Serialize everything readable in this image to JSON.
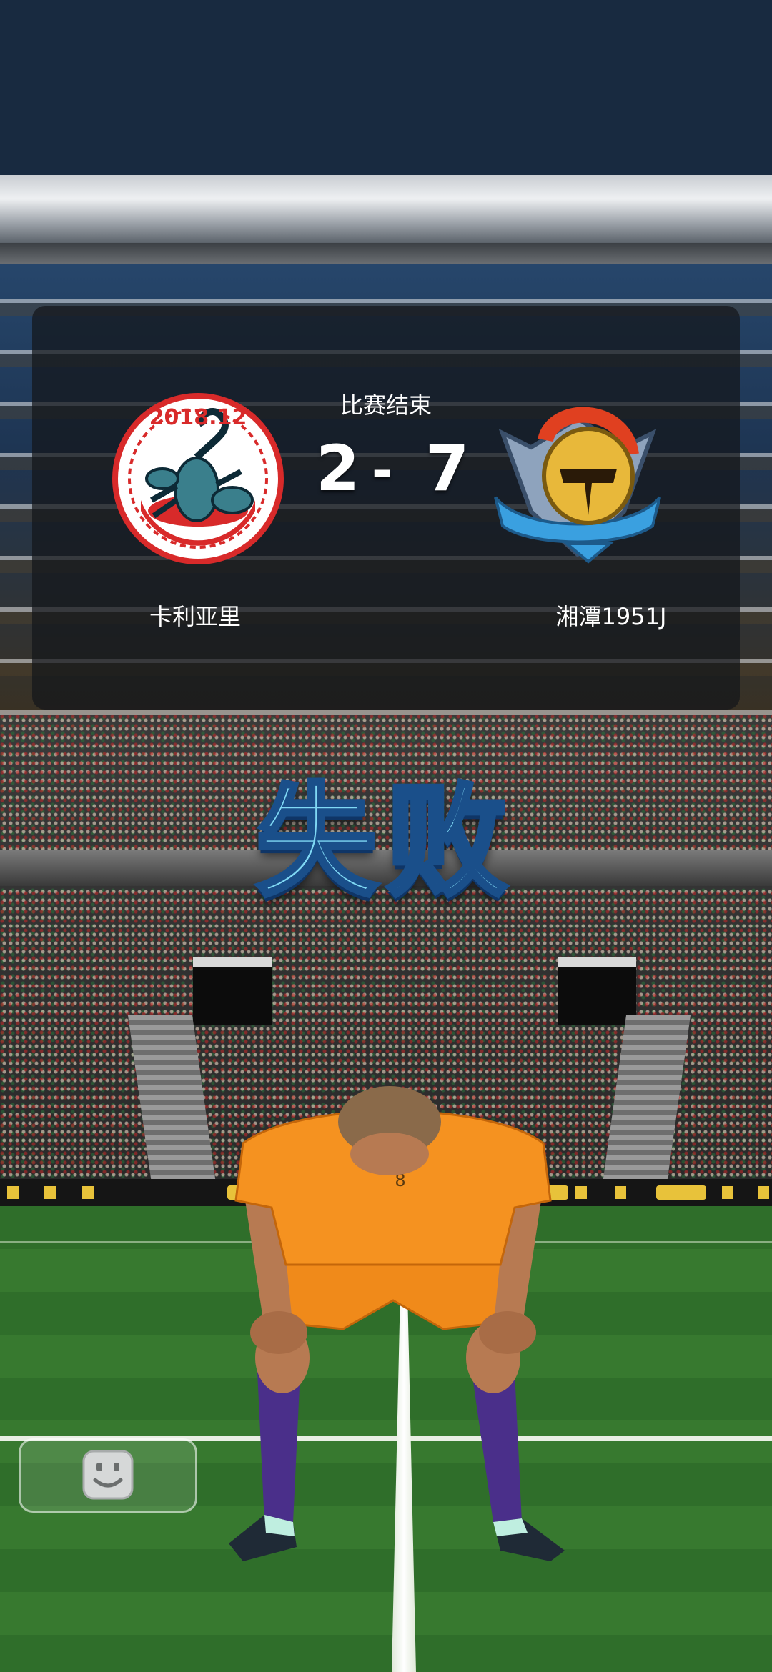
{
  "match": {
    "status_label": "比赛结束",
    "score_home": "2",
    "score_separator": "-",
    "score_away": "7",
    "home_team": {
      "name": "卡利亚里",
      "crest_text": "2018.12",
      "crest_icon": "scorpion-icon"
    },
    "away_team": {
      "name": "湘潭1951J",
      "crest_icon": "golden-helmet-icon"
    }
  },
  "result": {
    "label": "失败"
  },
  "player": {
    "jersey_number": "8"
  },
  "controls": {
    "chat_icon": "smiley-face-icon"
  },
  "colors": {
    "defeat_text": "#7fd8f4",
    "jersey": "#f08a1a",
    "pitch": "#37792f"
  }
}
